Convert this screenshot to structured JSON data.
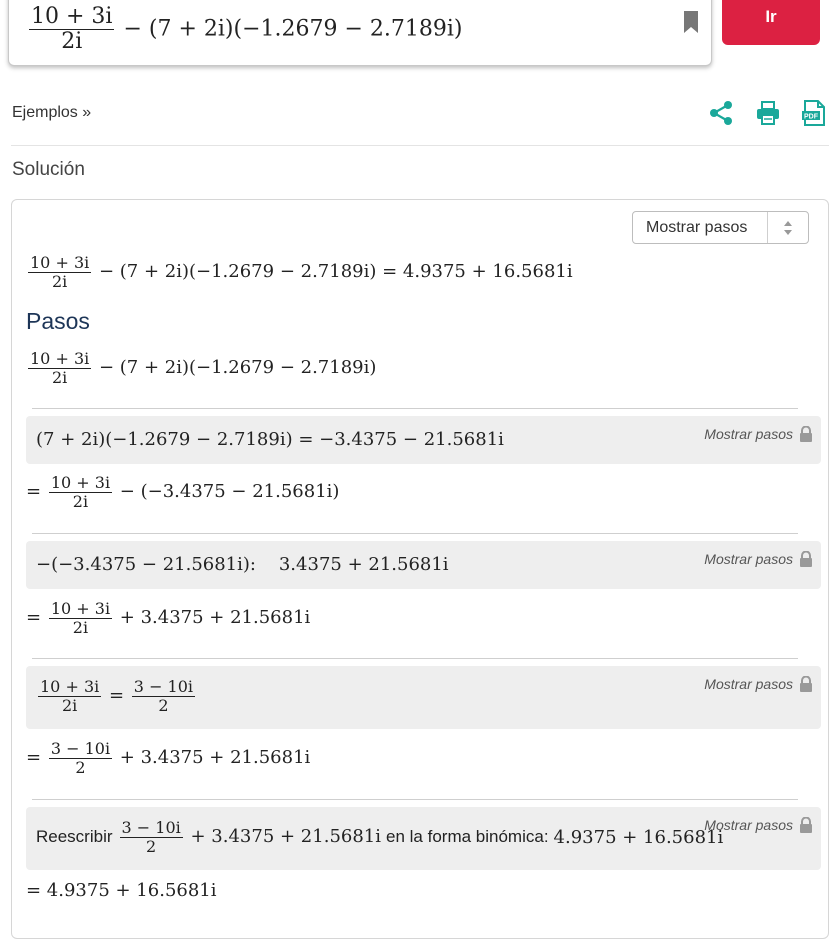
{
  "input": {
    "frac_num": "10 + 3i",
    "frac_den": "2i",
    "rest": "− (7 + 2i)(−1.2679 − 2.7189i)"
  },
  "go_button": "Ir",
  "examples_link": "Ejemplos »",
  "toolbar": {
    "share_icon": "share-icon",
    "print_icon": "printer-icon",
    "pdf_icon": "pdf-icon",
    "pdf_text": "PDF"
  },
  "solution_title": "Solución",
  "steps_select": {
    "selected": "Mostrar pasos"
  },
  "result": {
    "frac_num": "10 + 3i",
    "frac_den": "2i",
    "rest": "− (7 + 2i)(−1.2679 − 2.7189i) = 4.9375 + 16.5681i"
  },
  "pasos_title": "Pasos",
  "pasos_start": {
    "frac_num": "10 + 3i",
    "frac_den": "2i",
    "rest": "− (7 + 2i)(−1.2679 − 2.7189i)"
  },
  "steps": [
    {
      "box": "(7 + 2i)(−1.2679 − 2.7189i) = −3.4375 − 21.5681i",
      "show_steps": "Mostrar pasos",
      "result_prefix": "=",
      "result_frac_num": "10 + 3i",
      "result_frac_den": "2i",
      "result_rest": "− (−3.4375 − 21.5681i)"
    },
    {
      "box": "−(−3.4375 − 21.5681i):    3.4375 + 21.5681i",
      "show_steps": "Mostrar pasos",
      "result_prefix": "=",
      "result_frac_num": "10 + 3i",
      "result_frac_den": "2i",
      "result_rest": "+ 3.4375 + 21.5681i"
    },
    {
      "box_frac1_num": "10 + 3i",
      "box_frac1_den": "2i",
      "box_eq": "=",
      "box_frac2_num": "3 − 10i",
      "box_frac2_den": "2",
      "show_steps": "Mostrar pasos",
      "result_prefix": "=",
      "result_frac_num": "3 − 10i",
      "result_frac_den": "2",
      "result_rest": "+ 3.4375 + 21.5681i"
    },
    {
      "box_text1": "Reescribir",
      "box_frac_num": "3 − 10i",
      "box_frac_den": "2",
      "box_math1": "+ 3.4375 + 21.5681i",
      "box_text2": "en la forma binómica:",
      "box_math2": "4.9375 + 16.5681i",
      "show_steps": "Mostrar pasos",
      "result": "= 4.9375 + 16.5681i"
    }
  ],
  "colors": {
    "accent": "#dc2142",
    "teal": "#1aa89a",
    "heading": "#1d3557",
    "step_bg": "#eeeeee"
  }
}
